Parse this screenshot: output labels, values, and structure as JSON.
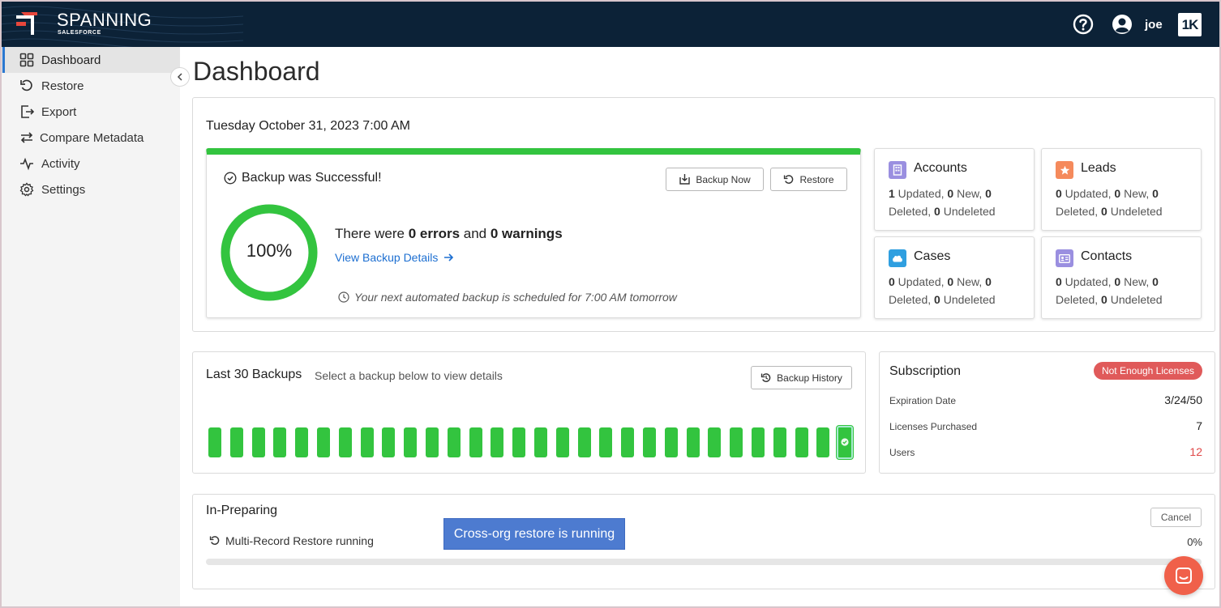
{
  "app": {
    "brand": "SPANNING",
    "brand_sub": "SALESFORCE",
    "user_name": "joe"
  },
  "nav": [
    {
      "label": "Dashboard",
      "icon": "grid-icon",
      "active": true
    },
    {
      "label": "Restore",
      "icon": "restore-icon"
    },
    {
      "label": "Export",
      "icon": "export-icon"
    },
    {
      "label": "Compare Metadata",
      "icon": "compare-icon"
    },
    {
      "label": "Activity",
      "icon": "activity-icon"
    },
    {
      "label": "Settings",
      "icon": "gear-icon"
    }
  ],
  "page": {
    "title": "Dashboard"
  },
  "backup": {
    "date": "Tuesday October 31, 2023 7:00 AM",
    "status": "Backup was Successful!",
    "backup_now_label": "Backup Now",
    "restore_label": "Restore",
    "percent": 100,
    "percent_label": "100%",
    "errors_prefix": "There were ",
    "errors_value": "0 errors",
    "errors_middle": " and ",
    "warnings_value": "0 warnings",
    "details_link": "View Backup Details",
    "next_backup": "Your next automated backup is scheduled for 7:00 AM tomorrow"
  },
  "objects": [
    {
      "name": "Accounts",
      "icon": "building-icon",
      "color": "#9a8fe0",
      "updated": "1",
      "new": "0",
      "deleted": "0",
      "undeleted": "0"
    },
    {
      "name": "Leads",
      "icon": "star-icon",
      "color": "#f58a5c",
      "updated": "0",
      "new": "0",
      "deleted": "0",
      "undeleted": "0"
    },
    {
      "name": "Cases",
      "icon": "briefcase-icon",
      "color": "#2f9fe0",
      "updated": "0",
      "new": "0",
      "deleted": "0",
      "undeleted": "0"
    },
    {
      "name": "Contacts",
      "icon": "contact-card-icon",
      "color": "#9a8fe0",
      "updated": "0",
      "new": "0",
      "deleted": "0",
      "undeleted": "0"
    }
  ],
  "stat_words": {
    "updated": " Updated, ",
    "new": " New, ",
    "deleted": "Deleted, ",
    "undeleted": " Undeleted"
  },
  "last30": {
    "title": "Last 30 Backups",
    "subtitle": "Select a backup below to view details",
    "history_label": "Backup History",
    "count": 30,
    "status": "success",
    "selected_index": 29,
    "color": "#33c43f"
  },
  "subscription": {
    "title": "Subscription",
    "badge": "Not Enough Licenses",
    "rows": [
      {
        "label": "Expiration Date",
        "value": "3/24/50"
      },
      {
        "label": "Licenses Purchased",
        "value": "7"
      },
      {
        "label": "Users",
        "value": "12",
        "alert": true
      }
    ]
  },
  "preparing": {
    "title": "In-Preparing",
    "task": "Multi-Record Restore running",
    "cancel_label": "Cancel",
    "progress": 0,
    "progress_label": "0%"
  },
  "tooltip": "Cross-org restore is running",
  "colors": {
    "header": "#0c2237",
    "success": "#33c43f",
    "link": "#1d6fd1",
    "alert": "#e05a5a"
  }
}
